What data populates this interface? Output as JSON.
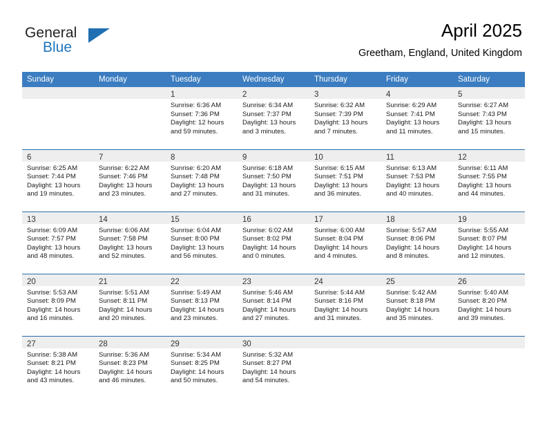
{
  "brand": {
    "name_part1": "General",
    "name_part2": "Blue",
    "logo_icon": "triangle-flag-icon"
  },
  "header": {
    "title": "April 2025",
    "subtitle": "Greetham, England, United Kingdom"
  },
  "colors": {
    "header_blue": "#3b7dc0",
    "row_divider_blue": "#2a6ca8",
    "daynum_band_gray": "#eeeeee",
    "brand_blue": "#2176bd"
  },
  "weekday_headers": [
    "Sunday",
    "Monday",
    "Tuesday",
    "Wednesday",
    "Thursday",
    "Friday",
    "Saturday"
  ],
  "weeks": [
    [
      {
        "day": "",
        "lines": []
      },
      {
        "day": "",
        "lines": []
      },
      {
        "day": "1",
        "lines": [
          "Sunrise: 6:36 AM",
          "Sunset: 7:36 PM",
          "Daylight: 12 hours",
          "and 59 minutes."
        ]
      },
      {
        "day": "2",
        "lines": [
          "Sunrise: 6:34 AM",
          "Sunset: 7:37 PM",
          "Daylight: 13 hours",
          "and 3 minutes."
        ]
      },
      {
        "day": "3",
        "lines": [
          "Sunrise: 6:32 AM",
          "Sunset: 7:39 PM",
          "Daylight: 13 hours",
          "and 7 minutes."
        ]
      },
      {
        "day": "4",
        "lines": [
          "Sunrise: 6:29 AM",
          "Sunset: 7:41 PM",
          "Daylight: 13 hours",
          "and 11 minutes."
        ]
      },
      {
        "day": "5",
        "lines": [
          "Sunrise: 6:27 AM",
          "Sunset: 7:43 PM",
          "Daylight: 13 hours",
          "and 15 minutes."
        ]
      }
    ],
    [
      {
        "day": "6",
        "lines": [
          "Sunrise: 6:25 AM",
          "Sunset: 7:44 PM",
          "Daylight: 13 hours",
          "and 19 minutes."
        ]
      },
      {
        "day": "7",
        "lines": [
          "Sunrise: 6:22 AM",
          "Sunset: 7:46 PM",
          "Daylight: 13 hours",
          "and 23 minutes."
        ]
      },
      {
        "day": "8",
        "lines": [
          "Sunrise: 6:20 AM",
          "Sunset: 7:48 PM",
          "Daylight: 13 hours",
          "and 27 minutes."
        ]
      },
      {
        "day": "9",
        "lines": [
          "Sunrise: 6:18 AM",
          "Sunset: 7:50 PM",
          "Daylight: 13 hours",
          "and 31 minutes."
        ]
      },
      {
        "day": "10",
        "lines": [
          "Sunrise: 6:15 AM",
          "Sunset: 7:51 PM",
          "Daylight: 13 hours",
          "and 36 minutes."
        ]
      },
      {
        "day": "11",
        "lines": [
          "Sunrise: 6:13 AM",
          "Sunset: 7:53 PM",
          "Daylight: 13 hours",
          "and 40 minutes."
        ]
      },
      {
        "day": "12",
        "lines": [
          "Sunrise: 6:11 AM",
          "Sunset: 7:55 PM",
          "Daylight: 13 hours",
          "and 44 minutes."
        ]
      }
    ],
    [
      {
        "day": "13",
        "lines": [
          "Sunrise: 6:09 AM",
          "Sunset: 7:57 PM",
          "Daylight: 13 hours",
          "and 48 minutes."
        ]
      },
      {
        "day": "14",
        "lines": [
          "Sunrise: 6:06 AM",
          "Sunset: 7:58 PM",
          "Daylight: 13 hours",
          "and 52 minutes."
        ]
      },
      {
        "day": "15",
        "lines": [
          "Sunrise: 6:04 AM",
          "Sunset: 8:00 PM",
          "Daylight: 13 hours",
          "and 56 minutes."
        ]
      },
      {
        "day": "16",
        "lines": [
          "Sunrise: 6:02 AM",
          "Sunset: 8:02 PM",
          "Daylight: 14 hours",
          "and 0 minutes."
        ]
      },
      {
        "day": "17",
        "lines": [
          "Sunrise: 6:00 AM",
          "Sunset: 8:04 PM",
          "Daylight: 14 hours",
          "and 4 minutes."
        ]
      },
      {
        "day": "18",
        "lines": [
          "Sunrise: 5:57 AM",
          "Sunset: 8:06 PM",
          "Daylight: 14 hours",
          "and 8 minutes."
        ]
      },
      {
        "day": "19",
        "lines": [
          "Sunrise: 5:55 AM",
          "Sunset: 8:07 PM",
          "Daylight: 14 hours",
          "and 12 minutes."
        ]
      }
    ],
    [
      {
        "day": "20",
        "lines": [
          "Sunrise: 5:53 AM",
          "Sunset: 8:09 PM",
          "Daylight: 14 hours",
          "and 16 minutes."
        ]
      },
      {
        "day": "21",
        "lines": [
          "Sunrise: 5:51 AM",
          "Sunset: 8:11 PM",
          "Daylight: 14 hours",
          "and 20 minutes."
        ]
      },
      {
        "day": "22",
        "lines": [
          "Sunrise: 5:49 AM",
          "Sunset: 8:13 PM",
          "Daylight: 14 hours",
          "and 23 minutes."
        ]
      },
      {
        "day": "23",
        "lines": [
          "Sunrise: 5:46 AM",
          "Sunset: 8:14 PM",
          "Daylight: 14 hours",
          "and 27 minutes."
        ]
      },
      {
        "day": "24",
        "lines": [
          "Sunrise: 5:44 AM",
          "Sunset: 8:16 PM",
          "Daylight: 14 hours",
          "and 31 minutes."
        ]
      },
      {
        "day": "25",
        "lines": [
          "Sunrise: 5:42 AM",
          "Sunset: 8:18 PM",
          "Daylight: 14 hours",
          "and 35 minutes."
        ]
      },
      {
        "day": "26",
        "lines": [
          "Sunrise: 5:40 AM",
          "Sunset: 8:20 PM",
          "Daylight: 14 hours",
          "and 39 minutes."
        ]
      }
    ],
    [
      {
        "day": "27",
        "lines": [
          "Sunrise: 5:38 AM",
          "Sunset: 8:21 PM",
          "Daylight: 14 hours",
          "and 43 minutes."
        ]
      },
      {
        "day": "28",
        "lines": [
          "Sunrise: 5:36 AM",
          "Sunset: 8:23 PM",
          "Daylight: 14 hours",
          "and 46 minutes."
        ]
      },
      {
        "day": "29",
        "lines": [
          "Sunrise: 5:34 AM",
          "Sunset: 8:25 PM",
          "Daylight: 14 hours",
          "and 50 minutes."
        ]
      },
      {
        "day": "30",
        "lines": [
          "Sunrise: 5:32 AM",
          "Sunset: 8:27 PM",
          "Daylight: 14 hours",
          "and 54 minutes."
        ]
      },
      {
        "day": "",
        "lines": []
      },
      {
        "day": "",
        "lines": []
      },
      {
        "day": "",
        "lines": []
      }
    ]
  ]
}
